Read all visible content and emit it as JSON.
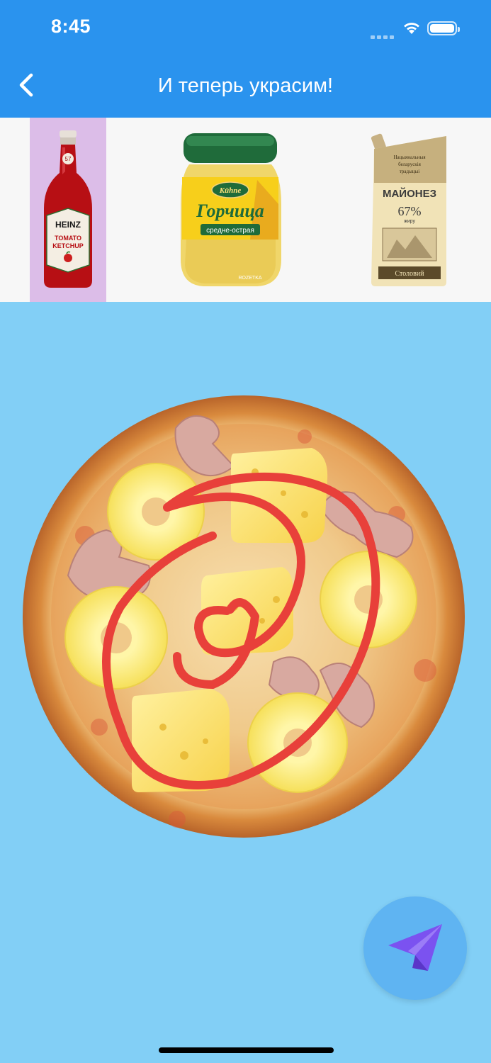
{
  "status_bar": {
    "time": "8:45"
  },
  "header": {
    "title": "И теперь украсим!",
    "back_icon": "chevron-left-icon"
  },
  "toolbar": {
    "selected_index": 0,
    "items": [
      {
        "name": "ketchup",
        "brand": "HEINZ",
        "line1": "TOMATO",
        "line2": "KETCHUP",
        "badge": "57"
      },
      {
        "name": "mustard",
        "brand": "Kühne",
        "title": "Горчица",
        "subtitle": "средне-острая",
        "watermark": "ROZETKA"
      },
      {
        "name": "mayonnaise",
        "top": "Нацыянальныя беларускія традыцыі",
        "title": "МАЙОНЕЗ",
        "percent": "67%",
        "fat": "жиру",
        "bottom": "Столовий"
      }
    ]
  },
  "canvas": {
    "background": "#82cff6",
    "toppings": [
      "pineapple",
      "cheese",
      "chicken"
    ],
    "drawing": {
      "color": "#e8403a",
      "shape": "spiral"
    }
  },
  "send_button": {
    "icon": "paper-plane-icon",
    "color": "#7b52f0"
  }
}
